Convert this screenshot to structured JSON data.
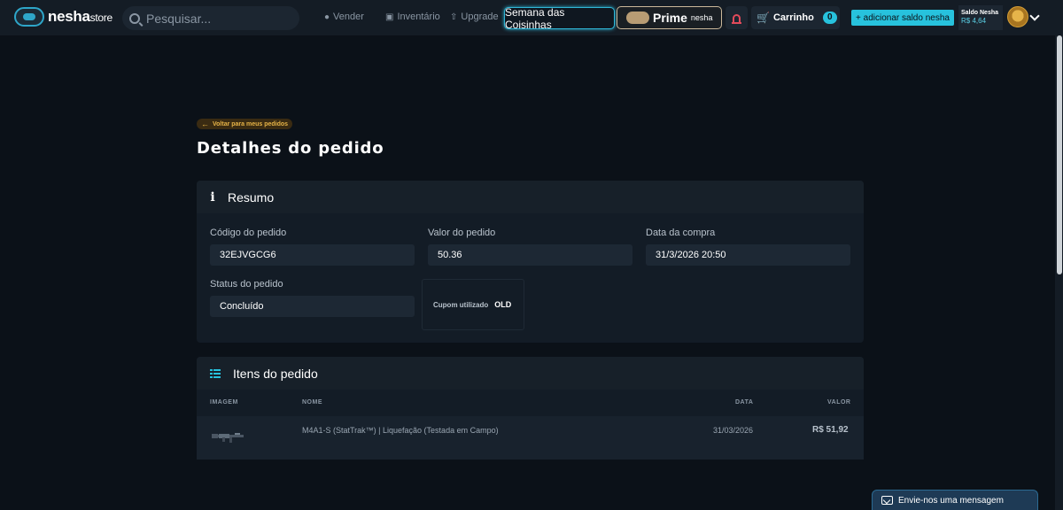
{
  "header": {
    "logo_main": "nesha",
    "logo_sub": "store",
    "search_placeholder": "Pesquisar...",
    "nav": {
      "sell": "Vender",
      "inventory": "Inventário",
      "upgrade": "Upgrade"
    },
    "semana_label": "Semana das Coisinhas",
    "prime_label": "Prime",
    "prime_sub": "nesha",
    "cart_label": "Carrinho",
    "cart_count": "0",
    "add_balance_label": "+ adicionar saldo nesha",
    "balance_label": "Saldo Nesha",
    "balance_value": "R$ 4,64"
  },
  "page": {
    "back_label": "Voltar para meus pedidos",
    "title": "Detalhes do pedido"
  },
  "summary": {
    "title": "Resumo",
    "order_code_label": "Código do pedido",
    "order_code": "32EJVGCG6",
    "order_value_label": "Valor do pedido",
    "order_value": "50.36",
    "purchase_date_label": "Data da compra",
    "purchase_date": "31/3/2026 20:50",
    "status_label": "Status do pedido",
    "status": "Concluído",
    "coupon_label": "Cupom utilizado",
    "coupon_code": "OLD"
  },
  "items": {
    "title": "Itens do pedido",
    "columns": {
      "image": "IMAGEM",
      "name": "NOME",
      "date": "DATA",
      "value": "VALOR"
    },
    "rows": [
      {
        "name": "M4A1-S (StatTrak™) | Liquefação (Testada em Campo)",
        "date": "31/03/2026",
        "value": "R$ 51,92"
      }
    ]
  },
  "chat": {
    "label": "Envie-nos uma mensagem"
  },
  "colors": {
    "accent": "#27c2dd",
    "back_button": "#e6b347",
    "background": "#0b1118",
    "panel": "#131c26"
  }
}
